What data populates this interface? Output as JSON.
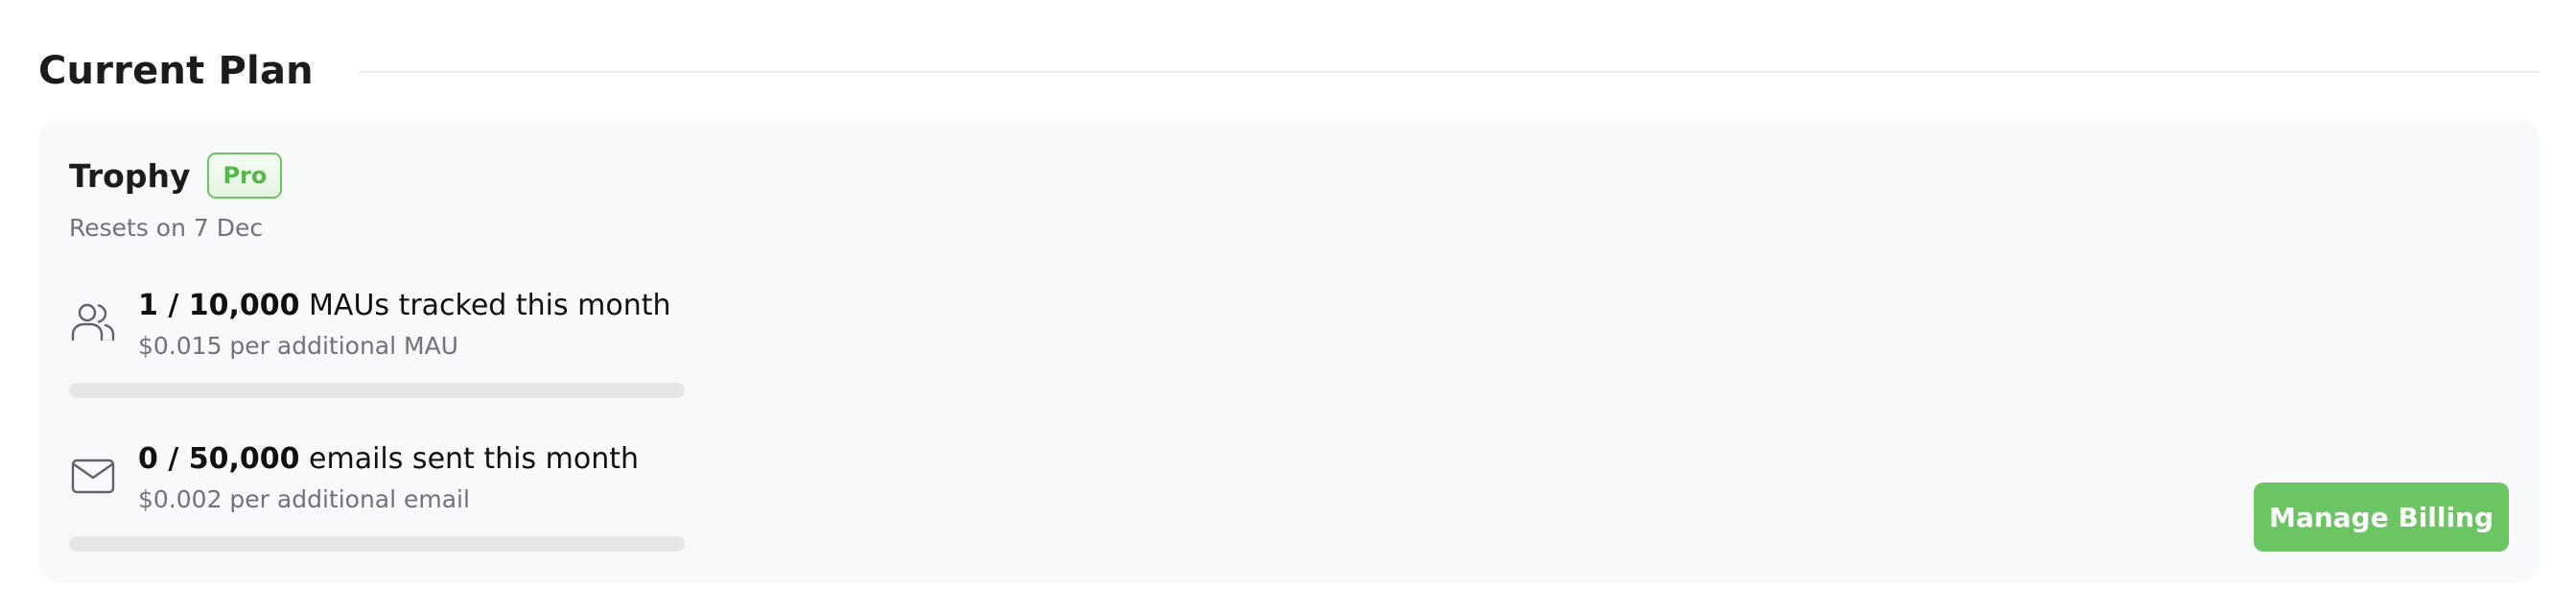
{
  "section": {
    "title": "Current Plan"
  },
  "plan": {
    "name": "Trophy",
    "badge": "Pro",
    "resets": "Resets on 7 Dec"
  },
  "usage": [
    {
      "icon": "users-icon",
      "count": "1 / 10,000",
      "label": " MAUs tracked this month",
      "sub": "$0.015 per additional MAU",
      "used": 1,
      "limit": 10000
    },
    {
      "icon": "mail-icon",
      "count": "0 / 50,000",
      "label": " emails sent this month",
      "sub": "$0.002 per additional email",
      "used": 0,
      "limit": 50000
    }
  ],
  "actions": {
    "manage_billing": "Manage Billing"
  },
  "colors": {
    "accent": "#6cc563",
    "card_background": "#f8f9fa",
    "bar_track": "#e5e6e8"
  }
}
